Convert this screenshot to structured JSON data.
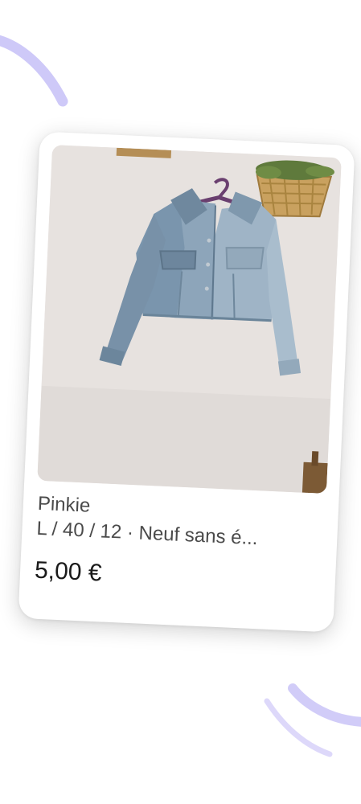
{
  "listing": {
    "brand": "Pinkie",
    "details": "L / 40 / 12 · Neuf sans é...",
    "price": "5,00 €",
    "image_alt": "Veste en jean courte"
  },
  "colors": {
    "accent_lavender": "#c9c3f7",
    "card_background": "#ffffff",
    "price_text": "#1a1a1a",
    "secondary_text": "#4a4a4a"
  },
  "icons": {
    "decor_top": "swoosh-arc",
    "decor_bottom": "swoosh-arc"
  }
}
